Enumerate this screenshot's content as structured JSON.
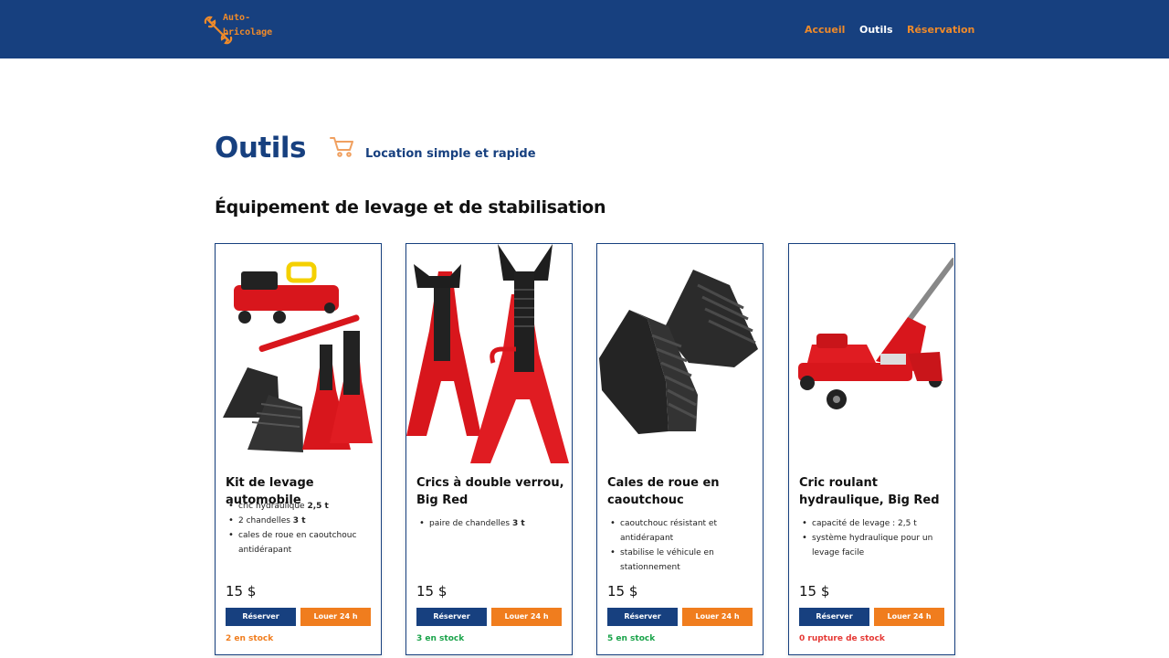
{
  "header": {
    "logo_line1": "Auto-",
    "logo_line2": "bricolage",
    "logo_icon": "wrench-icon",
    "nav": [
      {
        "label": "Accueil",
        "active": false
      },
      {
        "label": "Outils",
        "active": true
      },
      {
        "label": "Réservation",
        "active": false
      }
    ]
  },
  "page": {
    "title": "Outils",
    "cart_icon": "cart-icon",
    "tagline": "Location simple et rapide",
    "section_title": "Équipement de levage et de stabilisation"
  },
  "colors": {
    "primary": "#17407f",
    "accent": "#f07d1e",
    "stock_low": "#f07d1e",
    "stock_ok": "#1aa34a",
    "stock_out": "#e53935"
  },
  "products": [
    {
      "title": "Kit de levage automobile",
      "features": [
        {
          "text": "cric hydraulique ",
          "bold": "2,5 t"
        },
        {
          "text": "2 chandelles ",
          "bold": "3 t"
        },
        {
          "text": "cales de roue en caoutchouc antidérapant",
          "bold": ""
        }
      ],
      "price": "15 $",
      "reserve_label": "Réserver",
      "rent_label": "Louer 24 h",
      "stock": "2 en stock",
      "stock_status": "low"
    },
    {
      "title": "Crics à double verrou, Big Red",
      "features": [
        {
          "text": "paire de chandelles ",
          "bold": "3 t"
        }
      ],
      "price": "15 $",
      "reserve_label": "Réserver",
      "rent_label": "Louer 24 h",
      "stock": "3 en stock",
      "stock_status": "ok"
    },
    {
      "title": "Cales de roue en caoutchouc",
      "features": [
        {
          "text": "caoutchouc résistant et antidérapant",
          "bold": ""
        },
        {
          "text": "stabilise le véhicule en stationnement",
          "bold": ""
        }
      ],
      "price": "15 $",
      "reserve_label": "Réserver",
      "rent_label": "Louer 24 h",
      "stock": "5 en stock",
      "stock_status": "ok"
    },
    {
      "title": "Cric roulant hydraulique, Big Red",
      "features": [
        {
          "text": "capacité de levage : 2,5 t",
          "bold": ""
        },
        {
          "text": "système hydraulique pour un levage facile",
          "bold": ""
        }
      ],
      "price": "15 $",
      "reserve_label": "Réserver",
      "rent_label": "Louer 24 h",
      "stock": "0 rupture de stock",
      "stock_status": "out"
    }
  ]
}
